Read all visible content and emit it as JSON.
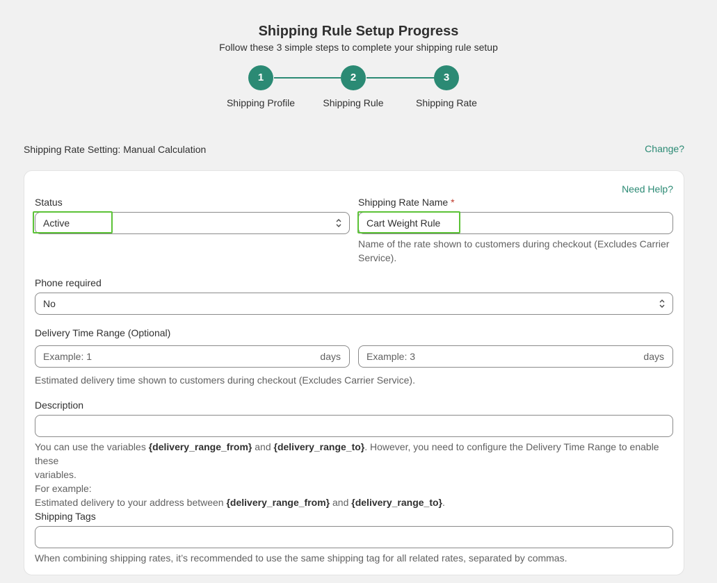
{
  "header": {
    "title": "Shipping Rule Setup Progress",
    "subtitle": "Follow these 3 simple steps to complete your shipping rule setup"
  },
  "steps": [
    {
      "number": "1",
      "label": "Shipping Profile"
    },
    {
      "number": "2",
      "label": "Shipping Rule"
    },
    {
      "number": "3",
      "label": "Shipping Rate"
    }
  ],
  "rate_setting": {
    "text": "Shipping Rate Setting: Manual Calculation",
    "change_link": "Change?"
  },
  "card": {
    "need_help": "Need Help?",
    "status": {
      "label": "Status",
      "value": "Active"
    },
    "rate_name": {
      "label": "Shipping Rate Name",
      "required_mark": "*",
      "value": "Cart Weight Rule",
      "help_line1": "Name of the rate shown to customers during checkout (Excludes Carrier",
      "help_line2": "Service)."
    },
    "phone": {
      "label": "Phone required",
      "value": "No"
    },
    "delivery": {
      "label": "Delivery Time Range (Optional)",
      "from_placeholder": "Example: 1",
      "to_placeholder": "Example: 3",
      "suffix": "days",
      "help": "Estimated delivery time shown to customers during checkout (Excludes Carrier Service)."
    },
    "description": {
      "label": "Description",
      "help_1a": "You can use the variables ",
      "var_from": "{delivery_range_from}",
      "and": " and ",
      "var_to": "{delivery_range_to}",
      "help_1b": ". However, you need to configure the Delivery Time Range to enable these",
      "help_1c": "variables.",
      "help_2": "For example:",
      "help_3a": "Estimated delivery to your address between ",
      "help_3b": "."
    },
    "tags": {
      "label": "Shipping Tags",
      "help": "When combining shipping rates, it’s recommended to use the same shipping tag for all related rates, separated by commas."
    }
  },
  "colors": {
    "accent": "#2b8a74",
    "highlight": "#5bc236",
    "background": "#f1f1f1"
  }
}
